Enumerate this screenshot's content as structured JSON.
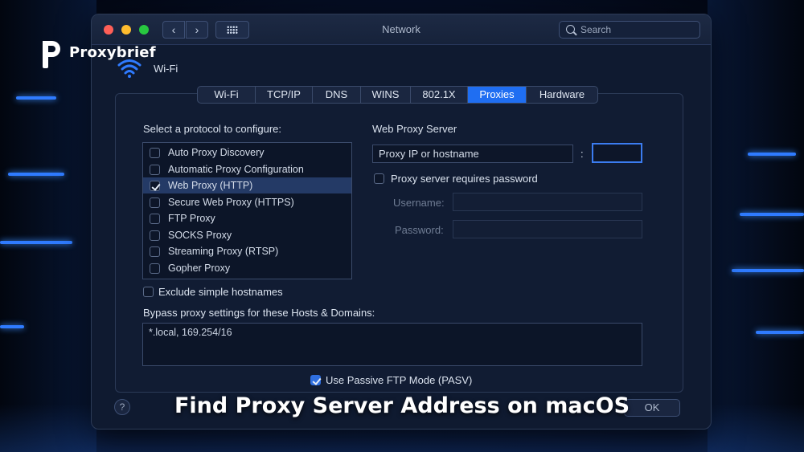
{
  "brand": {
    "name": "Proxybrief"
  },
  "window": {
    "title": "Network",
    "search_placeholder": "Search",
    "back_glyph": "‹",
    "forward_glyph": "›"
  },
  "interface": {
    "name": "Wi-Fi"
  },
  "tabs": [
    {
      "label": "Wi-Fi",
      "active": false
    },
    {
      "label": "TCP/IP",
      "active": false
    },
    {
      "label": "DNS",
      "active": false
    },
    {
      "label": "WINS",
      "active": false
    },
    {
      "label": "802.1X",
      "active": false
    },
    {
      "label": "Proxies",
      "active": true
    },
    {
      "label": "Hardware",
      "active": false
    }
  ],
  "protocols": {
    "heading": "Select a protocol to configure:",
    "items": [
      {
        "label": "Auto Proxy Discovery",
        "checked": false
      },
      {
        "label": "Automatic Proxy Configuration",
        "checked": false
      },
      {
        "label": "Web Proxy (HTTP)",
        "checked": true
      },
      {
        "label": "Secure Web Proxy (HTTPS)",
        "checked": false
      },
      {
        "label": "FTP Proxy",
        "checked": false
      },
      {
        "label": "SOCKS Proxy",
        "checked": false
      },
      {
        "label": "Streaming Proxy (RTSP)",
        "checked": false
      },
      {
        "label": "Gopher Proxy",
        "checked": false
      }
    ]
  },
  "server": {
    "heading": "Web Proxy Server",
    "host_value": "Proxy IP or hostname",
    "colon": ":",
    "port_value": "",
    "requires_password_label": "Proxy server requires password",
    "username_label": "Username:",
    "password_label": "Password:"
  },
  "exclude_simple_label": "Exclude simple hostnames",
  "bypass": {
    "label": "Bypass proxy settings for these Hosts & Domains:",
    "value": "*.local, 169.254/16"
  },
  "passive_ftp_label": "Use Passive FTP Mode (PASV)",
  "footer": {
    "help_label": "?",
    "ok_label": "OK"
  },
  "caption": "Find Proxy Server Address on macOS",
  "colors": {
    "accent": "#1f6ef2",
    "window_bg": "#0f1a30"
  }
}
